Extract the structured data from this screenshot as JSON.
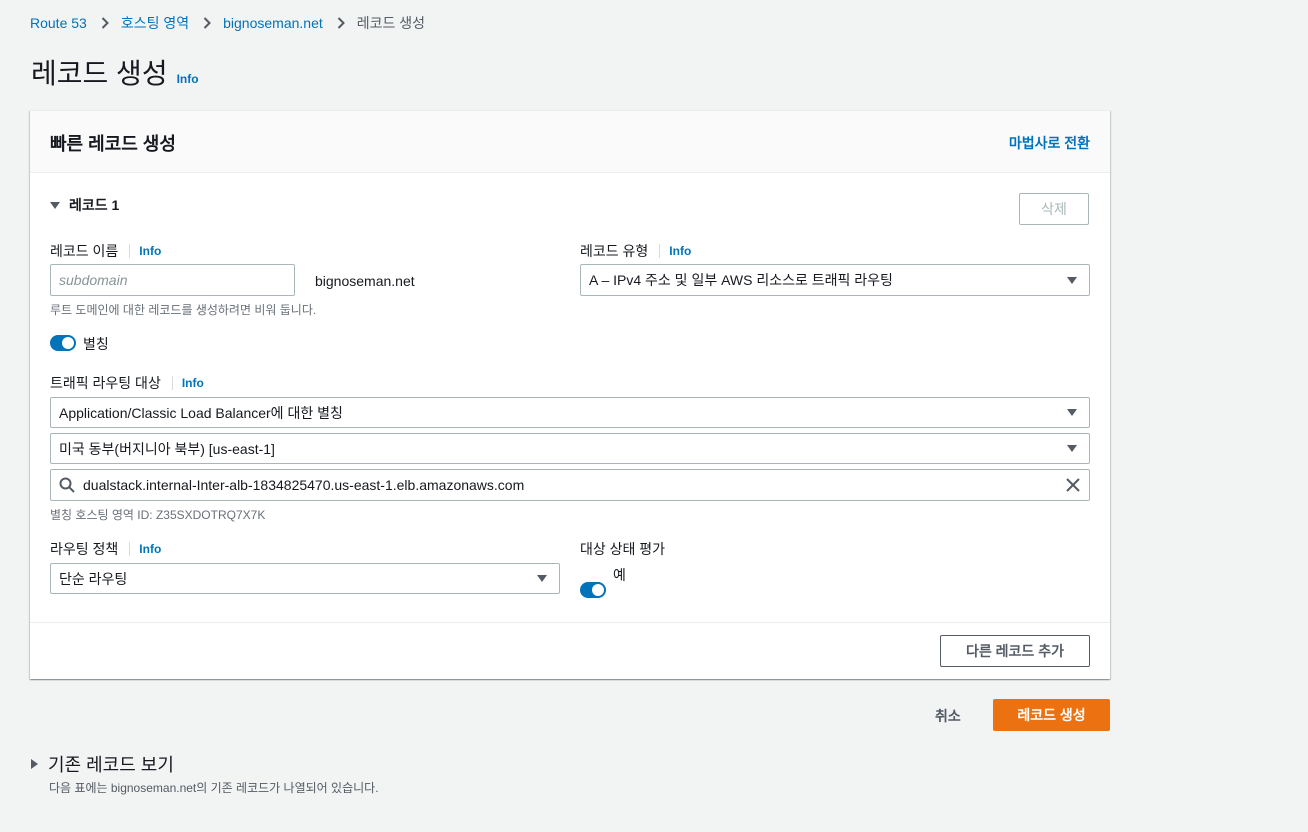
{
  "breadcrumb": {
    "items": [
      "Route 53",
      "호스팅 영역",
      "bignoseman.net"
    ],
    "current": "레코드 생성"
  },
  "page": {
    "title": "레코드 생성",
    "info": "Info"
  },
  "panel": {
    "title": "빠른 레코드 생성",
    "wizard_link": "마법사로 전환",
    "record_header": "레코드 1",
    "delete_button": "삭제",
    "record_name": {
      "label": "레코드 이름",
      "info": "Info",
      "placeholder": "subdomain",
      "value": "",
      "suffix": "bignoseman.net",
      "hint": "루트 도메인에 대한 레코드를 생성하려면 비워 둡니다."
    },
    "record_type": {
      "label": "레코드 유형",
      "info": "Info",
      "selected": "A – IPv4 주소 및 일부 AWS 리소스로 트래픽 라우팅"
    },
    "alias": {
      "label": "별칭",
      "enabled": true
    },
    "traffic_target": {
      "label": "트래픽 라우팅 대상",
      "info": "Info",
      "endpoint": "Application/Classic Load Balancer에 대한 별칭",
      "region": "미국 동부(버지니아 북부) [us-east-1]",
      "search_value": "dualstack.internal-Inter-alb-1834825470.us-east-1.elb.amazonaws.com",
      "zone_hint": "별칭 호스팅 영역 ID: Z35SXDOTRQ7X7K"
    },
    "routing_policy": {
      "label": "라우팅 정책",
      "info": "Info",
      "selected": "단순 라우팅"
    },
    "health_eval": {
      "label": "대상 상태 평가",
      "toggle_label": "예",
      "enabled": true
    },
    "add_record_button": "다른 레코드 추가"
  },
  "actions": {
    "cancel": "취소",
    "create": "레코드 생성"
  },
  "existing": {
    "title": "기존 레코드 보기",
    "description": "다음 표에는 bignoseman.net의 기존 레코드가 나열되어 있습니다."
  },
  "colors": {
    "link": "#0073bb",
    "primary": "#ec7211",
    "background": "#f2f3f3"
  }
}
